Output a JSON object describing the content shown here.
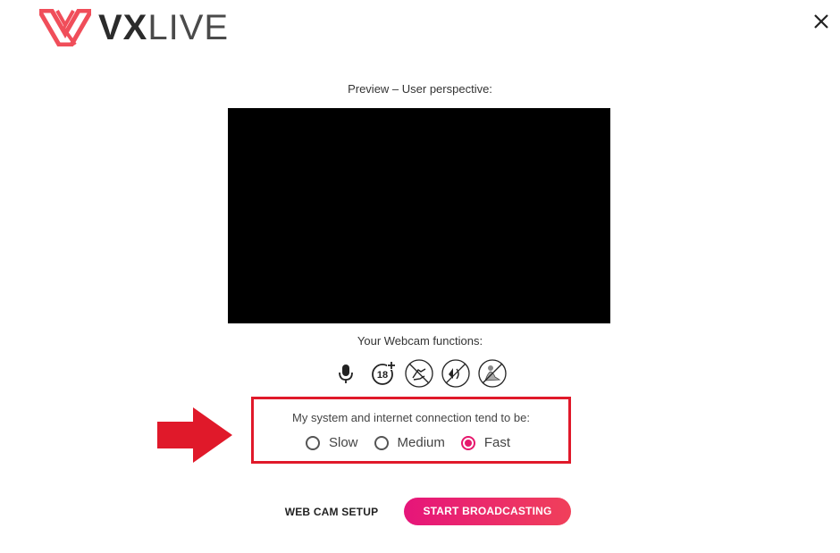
{
  "brand": {
    "logo_bold": "VX",
    "logo_light": "LIVE",
    "accent": "#e6186d",
    "logo_color": "#f04e5a"
  },
  "header": {
    "close_icon": "close-icon"
  },
  "preview": {
    "label": "Preview – User perspective:"
  },
  "functions": {
    "label": "Your Webcam functions:",
    "icons": [
      "microphone-icon",
      "age-18-plus-icon",
      "no-feet-icon",
      "no-anal-icon",
      "no-outdoor-icon"
    ]
  },
  "connection": {
    "label": "My system and internet connection tend to be:",
    "options": [
      {
        "label": "Slow",
        "selected": false
      },
      {
        "label": "Medium",
        "selected": false
      },
      {
        "label": "Fast",
        "selected": true
      }
    ],
    "highlight_color": "#e0192a"
  },
  "actions": {
    "setup_label": "WEB CAM SETUP",
    "broadcast_label": "START BROADCASTING"
  }
}
